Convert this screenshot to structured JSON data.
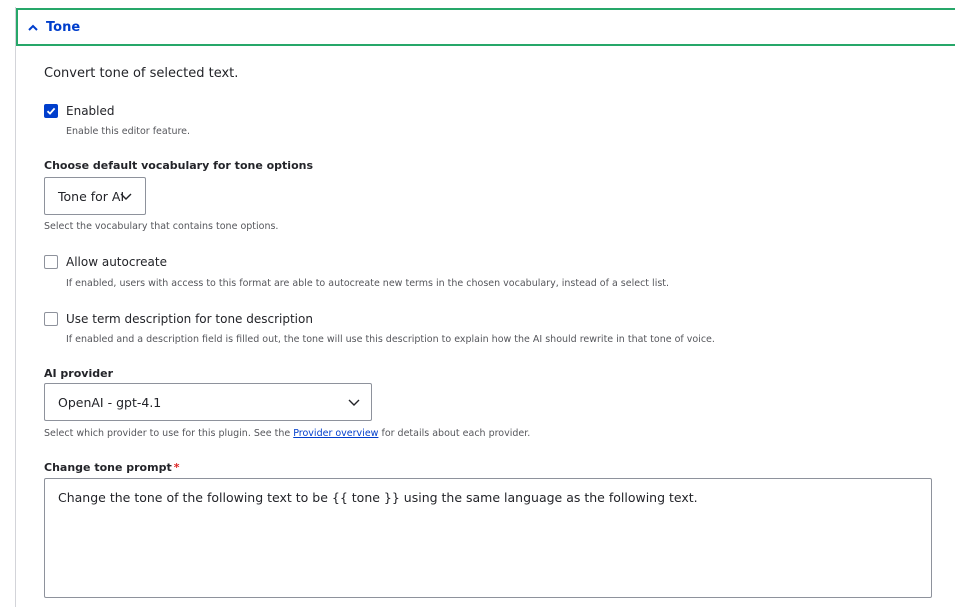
{
  "section": {
    "title": "Tone",
    "description": "Convert tone of selected text."
  },
  "enabled": {
    "label": "Enabled",
    "checked": true,
    "help": "Enable this editor feature."
  },
  "vocabulary": {
    "label": "Choose default vocabulary for tone options",
    "selected": "Tone for AI",
    "help": "Select the vocabulary that contains tone options."
  },
  "autocreate": {
    "label": "Allow autocreate",
    "checked": false,
    "help": "If enabled, users with access to this format are able to autocreate new terms in the chosen vocabulary, instead of a select list."
  },
  "term_description": {
    "label": "Use term description for tone description",
    "checked": false,
    "help": "If enabled and a description field is filled out, the tone will use this description to explain how the AI should rewrite in that tone of voice."
  },
  "provider": {
    "label": "AI provider",
    "selected": "OpenAI - gpt-4.1",
    "help_before": "Select which provider to use for this plugin. See the",
    "help_link": "Provider overview",
    "help_after": "for details about each provider."
  },
  "prompt": {
    "label": "Change tone prompt",
    "required_mark": "*",
    "value": "Change the tone of the following text to be {{ tone }} using the same language as the following text."
  },
  "colors": {
    "accent": "#003ecc",
    "focus_border": "#26a769",
    "required": "#dc2323"
  }
}
